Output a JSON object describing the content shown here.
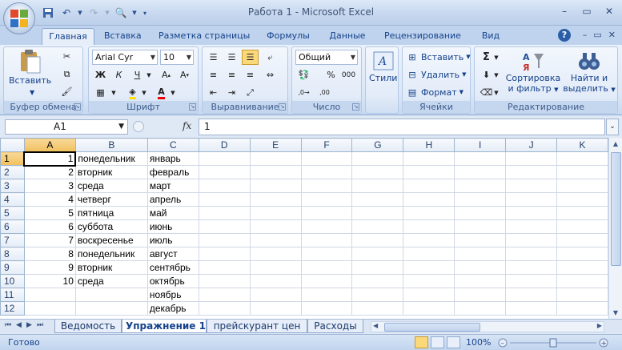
{
  "window": {
    "title": "Работа 1 - Microsoft Excel"
  },
  "tabs": [
    "Главная",
    "Вставка",
    "Разметка страницы",
    "Формулы",
    "Данные",
    "Рецензирование",
    "Вид"
  ],
  "ribbon": {
    "clipboard": {
      "label": "Буфер обмена",
      "paste": "Вставить"
    },
    "font": {
      "label": "Шрифт",
      "name": "Arial Cyr",
      "size": "10"
    },
    "alignment": {
      "label": "Выравнивание"
    },
    "number": {
      "label": "Число",
      "format": "Общий"
    },
    "styles": {
      "label": "Стили"
    },
    "cells": {
      "label": "Ячейки",
      "insert": "Вставить",
      "delete": "Удалить",
      "format": "Формат"
    },
    "editing": {
      "label": "Редактирование",
      "sort": "Сортировка",
      "sort2": "и фильтр",
      "find": "Найти и",
      "find2": "выделить"
    }
  },
  "formula": {
    "namebox": "A1",
    "fx": "fx",
    "value": "1"
  },
  "grid": {
    "columns": [
      "A",
      "B",
      "C",
      "D",
      "E",
      "F",
      "G",
      "H",
      "I",
      "J",
      "K"
    ],
    "rows": [
      {
        "n": "1",
        "a": "1",
        "b": "понедельник",
        "c": "январь"
      },
      {
        "n": "2",
        "a": "2",
        "b": "вторник",
        "c": "февраль"
      },
      {
        "n": "3",
        "a": "3",
        "b": "среда",
        "c": "март"
      },
      {
        "n": "4",
        "a": "4",
        "b": "четверг",
        "c": "апрель"
      },
      {
        "n": "5",
        "a": "5",
        "b": "пятница",
        "c": "май"
      },
      {
        "n": "6",
        "a": "6",
        "b": "суббота",
        "c": "июнь"
      },
      {
        "n": "7",
        "a": "7",
        "b": "воскресенье",
        "c": "июль"
      },
      {
        "n": "8",
        "a": "8",
        "b": "понедельник",
        "c": "август"
      },
      {
        "n": "9",
        "a": "9",
        "b": "вторник",
        "c": "сентябрь"
      },
      {
        "n": "10",
        "a": "10",
        "b": "среда",
        "c": "октябрь"
      },
      {
        "n": "11",
        "a": "",
        "b": "",
        "c": "ноябрь"
      },
      {
        "n": "12",
        "a": "",
        "b": "",
        "c": "декабрь"
      }
    ]
  },
  "sheets": [
    "Ведомость",
    "Упражнение 1",
    "прейскурант цен",
    "Расходы"
  ],
  "active_sheet": "Упражнение 1",
  "status": {
    "text": "Готово",
    "zoom": "100%"
  },
  "colors": {
    "active_tab": "#e6eefa",
    "highlight": "#fbd87a",
    "ribbon_text": "#15428b"
  }
}
